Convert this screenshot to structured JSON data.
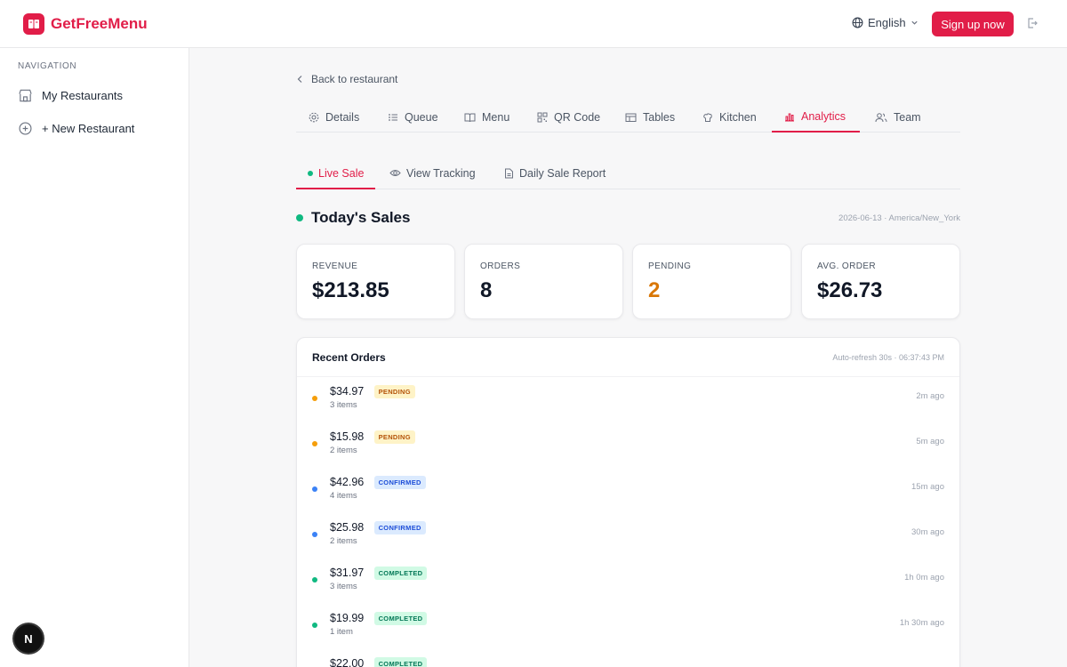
{
  "header": {
    "brand": "GetFreeMenu",
    "language": "English",
    "signup_label": "Sign up now"
  },
  "sidebar": {
    "heading": "NAVIGATION",
    "items": [
      {
        "label": "My Restaurants",
        "icon": "store-icon"
      },
      {
        "label": "+ New Restaurant",
        "icon": "plus-circle-icon"
      }
    ],
    "badge": "N"
  },
  "main": {
    "back_label": "Back to restaurant",
    "tabs": [
      {
        "label": "Details",
        "icon": "gear-icon"
      },
      {
        "label": "Queue",
        "icon": "list-icon"
      },
      {
        "label": "Menu",
        "icon": "book-icon"
      },
      {
        "label": "QR Code",
        "icon": "qr-icon"
      },
      {
        "label": "Tables",
        "icon": "table-icon"
      },
      {
        "label": "Kitchen",
        "icon": "chef-icon"
      },
      {
        "label": "Analytics",
        "icon": "bar-chart-icon",
        "active": true
      },
      {
        "label": "Team",
        "icon": "users-icon"
      }
    ],
    "subtabs": [
      {
        "label": "Live Sale",
        "active": true
      },
      {
        "label": "View Tracking",
        "icon": "eye-icon"
      },
      {
        "label": "Daily Sale Report",
        "icon": "file-icon"
      }
    ],
    "sales_title": "Today's Sales",
    "sales_date": "2026-06-13 · America/New_York",
    "stats": [
      {
        "label": "REVENUE",
        "value": "$213.85"
      },
      {
        "label": "ORDERS",
        "value": "8"
      },
      {
        "label": "PENDING",
        "value": "2"
      },
      {
        "label": "AVG. ORDER",
        "value": "$26.73"
      }
    ],
    "recent_orders": {
      "title": "Recent Orders",
      "meta": "Auto-refresh 30s · 06:37:43 PM",
      "orders": [
        {
          "amount": "$34.97",
          "status": "PENDING",
          "items": "3 items",
          "ago": "2m ago"
        },
        {
          "amount": "$15.98",
          "status": "PENDING",
          "items": "2 items",
          "ago": "5m ago"
        },
        {
          "amount": "$42.96",
          "status": "CONFIRMED",
          "items": "4 items",
          "ago": "15m ago"
        },
        {
          "amount": "$25.98",
          "status": "CONFIRMED",
          "items": "2 items",
          "ago": "30m ago"
        },
        {
          "amount": "$31.97",
          "status": "COMPLETED",
          "items": "3 items",
          "ago": "1h 0m ago"
        },
        {
          "amount": "$19.99",
          "status": "COMPLETED",
          "items": "1 item",
          "ago": "1h 30m ago"
        },
        {
          "amount": "$22.00",
          "status": "COMPLETED",
          "items": "",
          "ago": ""
        }
      ]
    }
  },
  "colors": {
    "accent": "#e11d48",
    "pending": "#f59e0b",
    "confirmed": "#3b82f6",
    "completed": "#10b981"
  }
}
